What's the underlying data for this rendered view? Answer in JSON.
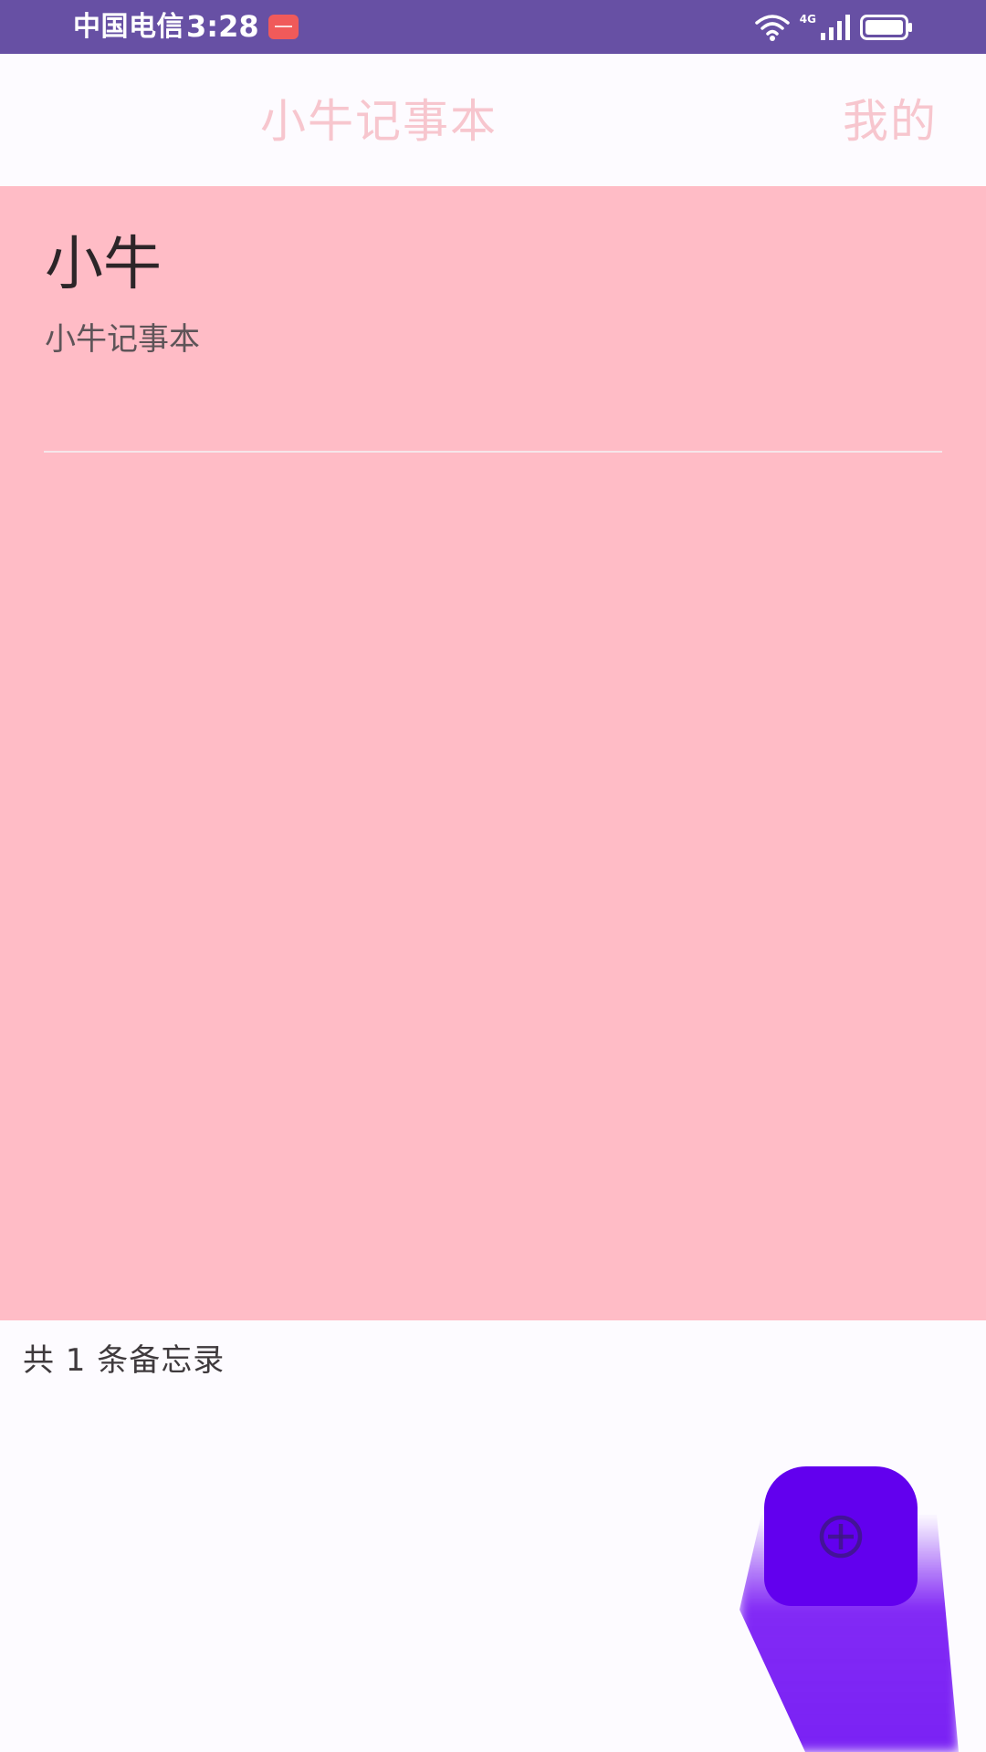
{
  "status_bar": {
    "carrier": "中国电信",
    "time": "3:28",
    "network": "4G",
    "background_color": "#6750A4",
    "icons": [
      "app-notification-icon",
      "wifi-icon",
      "cellular-signal-icon",
      "battery-icon"
    ]
  },
  "app_bar": {
    "title": "小牛记事本",
    "profile_label": "我的",
    "text_color": "#F7C6CE"
  },
  "notes": [
    {
      "title": "小牛",
      "content": "小牛记事本"
    }
  ],
  "content_background_color": "#FFBCC6",
  "footer": {
    "count_text": "共 1 条备忘录"
  },
  "fab": {
    "icon": "add-circle-icon",
    "color": "#6200EE"
  }
}
